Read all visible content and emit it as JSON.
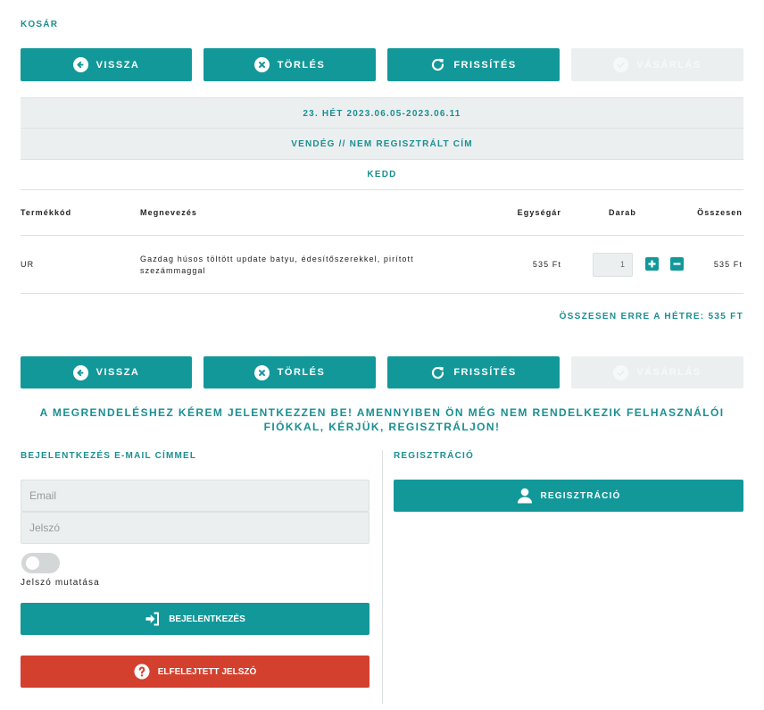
{
  "page_title": "KOSÁR",
  "actions": {
    "back": "VISSZA",
    "delete": "TÖRLÉS",
    "refresh": "FRISSÍTÉS",
    "purchase": "VÁSÁRLÁS"
  },
  "week": "23. HÉT 2023.06.05-2023.06.11",
  "address": "VENDÉG // NEM REGISZTRÁLT CÍM",
  "day": "KEDD",
  "table": {
    "headers": [
      "Termékkód",
      "Megnevezés",
      "Egységár",
      "Darab",
      "Összesen"
    ],
    "rows": [
      {
        "code": "UR",
        "name": "Gazdag húsos töltött update batyu, édesítőszerekkel, pirított szezámmaggal",
        "unit_price": "535 Ft",
        "quantity": "1",
        "total": "535 Ft"
      }
    ]
  },
  "week_total": "ÖSSZESEN ERRE A HÉTRE: 535 FT",
  "login_notice": "A MEGRENDELÉSHEZ KÉREM JELENTKEZZEN BE! AMENNYIBEN ÖN MÉG NEM RENDELKEZIK FELHASZNÁLÓI FIÓKKAL, KÉRJÜK, REGISZTRÁLJON!",
  "login": {
    "title": "BEJELENTKEZÉS E-MAIL CÍMMEL",
    "email_placeholder": "Email",
    "password_placeholder": "Jelszó",
    "show_password_label": "Jelszó mutatása",
    "show_password_on": false,
    "login_button": "BEJELENTKEZÉS",
    "forgot_button": "ELFELEJTETT JELSZÓ"
  },
  "registration": {
    "title": "REGISZTRÁCIÓ",
    "button": "REGISZTRÁCIÓ"
  },
  "colors": {
    "accent": "#13989a",
    "danger": "#d3402e",
    "disabled": "#eceff0"
  }
}
